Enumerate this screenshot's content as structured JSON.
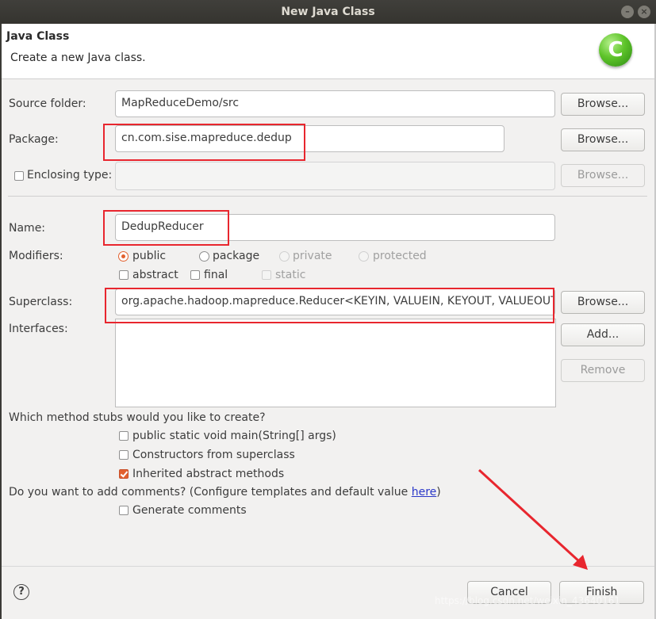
{
  "window": {
    "title": "New Java Class"
  },
  "header": {
    "title": "Java Class",
    "description": "Create a new Java class.",
    "logo_letter": "C"
  },
  "source_folder": {
    "label": "Source folder:",
    "value": "MapReduceDemo/src",
    "browse": "Browse..."
  },
  "package": {
    "label": "Package:",
    "value": "cn.com.sise.mapreduce.dedup",
    "browse": "Browse..."
  },
  "enclosing_type": {
    "label": "Enclosing type:",
    "checked": false,
    "value": "",
    "browse": "Browse..."
  },
  "name": {
    "label": "Name:",
    "value": "DedupReducer"
  },
  "modifiers": {
    "label": "Modifiers:",
    "access": [
      {
        "label": "public",
        "selected": true,
        "enabled": true
      },
      {
        "label": "package",
        "selected": false,
        "enabled": true
      },
      {
        "label": "private",
        "selected": false,
        "enabled": false
      },
      {
        "label": "protected",
        "selected": false,
        "enabled": false
      }
    ],
    "other": [
      {
        "label": "abstract",
        "checked": false,
        "enabled": true
      },
      {
        "label": "final",
        "checked": false,
        "enabled": true
      },
      {
        "label": "static",
        "checked": false,
        "enabled": false
      }
    ]
  },
  "superclass": {
    "label": "Superclass:",
    "value": "org.apache.hadoop.mapreduce.Reducer<KEYIN, VALUEIN, KEYOUT, VALUEOUT>",
    "browse": "Browse..."
  },
  "interfaces": {
    "label": "Interfaces:",
    "add": "Add...",
    "remove": "Remove"
  },
  "stubs": {
    "question": "Which method stubs would you like to create?",
    "items": [
      {
        "label": "public static void main(String[] args)",
        "checked": false
      },
      {
        "label": "Constructors from superclass",
        "checked": false
      },
      {
        "label": "Inherited abstract methods",
        "checked": true
      }
    ]
  },
  "comments": {
    "question_prefix": "Do you want to add comments? (Configure templates and default value ",
    "link": "here",
    "question_suffix": ")",
    "generate": {
      "label": "Generate comments",
      "checked": false
    }
  },
  "footer": {
    "cancel": "Cancel",
    "finish": "Finish",
    "help_symbol": "?"
  },
  "watermark": "https://blog.csdn.net/weixin_43640161",
  "colors": {
    "highlight": "#e8262e",
    "accent": "#e2612f",
    "link": "#2a37c8"
  }
}
